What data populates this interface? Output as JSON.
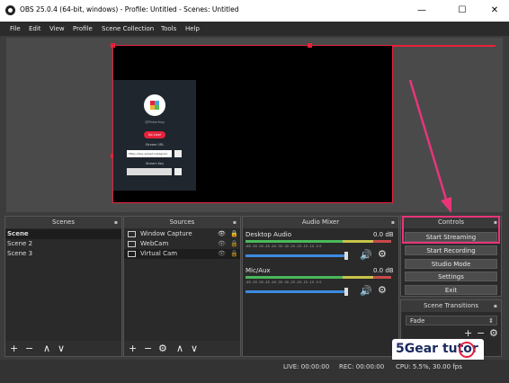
{
  "window": {
    "title": "OBS 25.0.4 (64-bit, windows) - Profile: Untitled - Scenes: Untitled",
    "min": "—",
    "max": "☐",
    "close": "✕"
  },
  "menu": [
    "File",
    "Edit",
    "View",
    "Profile",
    "Scene Collection",
    "Tools",
    "Help"
  ],
  "capture": {
    "line1": "@Pinkerfrog",
    "button": "Go Live!",
    "label1": "Stream URL",
    "url_value": "https://live.upload.instagram",
    "label2": "Stream Key"
  },
  "scenes": {
    "title": "Scenes",
    "items": [
      "Scene",
      "Scene 2",
      "Scene 3"
    ]
  },
  "sources": {
    "title": "Sources",
    "items": [
      "Window Capture",
      "WebCam",
      "Virtual Cam"
    ]
  },
  "audio": {
    "title": "Audio Mixer",
    "channels": [
      {
        "name": "Desktop Audio",
        "db": "0.0 dB",
        "level": 0.0,
        "volume": 0.78
      },
      {
        "name": "Mic/Aux",
        "db": "0.0 dB",
        "level": 0.0,
        "volume": 0.78
      }
    ],
    "scale": [
      "-60",
      "-55",
      "-50",
      "-45",
      "-40",
      "-35",
      "-30",
      "-25",
      "-20",
      "-15",
      "-10",
      "-5",
      "0"
    ]
  },
  "controls": {
    "title": "Controls",
    "buttons": [
      "Start Streaming",
      "Start Recording",
      "Studio Mode",
      "Settings",
      "Exit"
    ]
  },
  "transitions": {
    "title": "Scene Transitions",
    "selected": "Fade"
  },
  "status": {
    "live": "LIVE: 00:00:00",
    "rec": "REC: 00:00:00",
    "cpu": "CPU: 5.5%, 30.00 fps"
  },
  "watermark": {
    "text": "5Gear tutor"
  },
  "colors": {
    "accent": "#e8213b",
    "highlight": "#e8357a",
    "meter_green": "#49b85a",
    "meter_yellow": "#c9c34a",
    "meter_red": "#c84a4a",
    "slider": "#3d8ae0"
  },
  "icons": {
    "dock_float": "▪",
    "add": "+",
    "remove": "−",
    "up": "∧",
    "down": "∨",
    "gear": "⚙",
    "eye": "👁",
    "lock": "🔒"
  }
}
